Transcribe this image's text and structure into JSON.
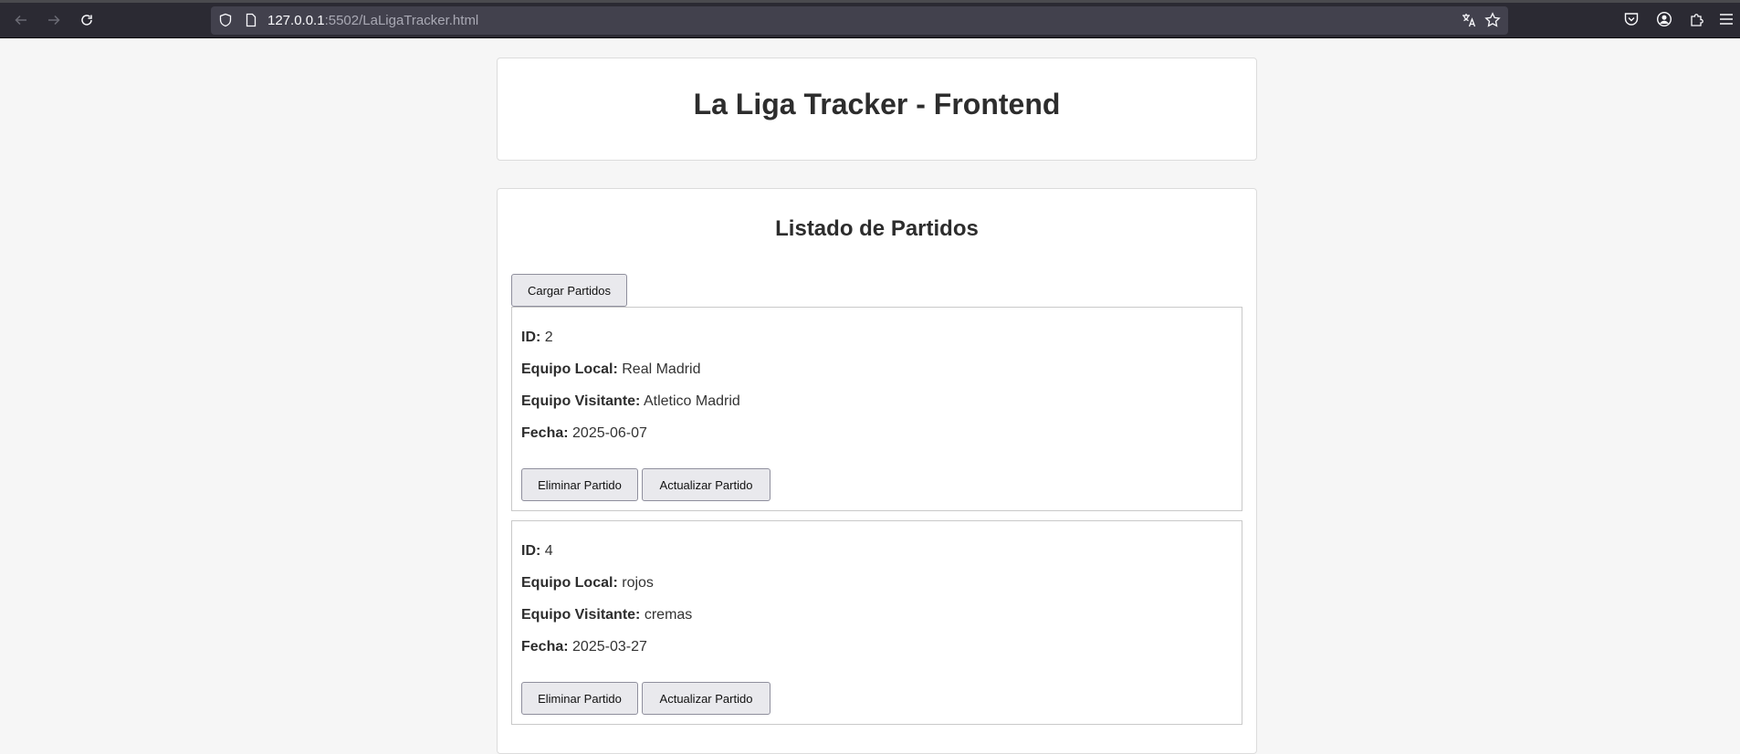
{
  "browser": {
    "url_host": "127.0.0.1",
    "url_path": ":5502/LaLigaTracker.html"
  },
  "header": {
    "title": "La Liga Tracker - Frontend"
  },
  "list": {
    "title": "Listado de Partidos",
    "load_button": "Cargar Partidos",
    "labels": {
      "id": "ID:",
      "home": "Equipo Local:",
      "away": "Equipo Visitante:",
      "date": "Fecha:"
    },
    "delete_button": "Eliminar Partido",
    "update_button": "Actualizar Partido",
    "matches": [
      {
        "id": "2",
        "home": "Real Madrid",
        "away": "Atletico Madrid",
        "date": "2025-06-07"
      },
      {
        "id": "4",
        "home": "rojos",
        "away": "cremas",
        "date": "2025-03-27"
      }
    ]
  }
}
